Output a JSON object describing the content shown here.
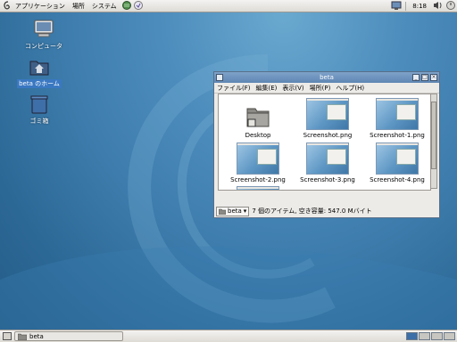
{
  "top_panel": {
    "menus": [
      {
        "label": "アプリケーション"
      },
      {
        "label": "場所"
      },
      {
        "label": "システム"
      }
    ],
    "clock": "8:18"
  },
  "desktop": {
    "icons": [
      {
        "label": "コンピュータ"
      },
      {
        "label": "beta のホーム"
      },
      {
        "label": "ゴミ箱"
      }
    ]
  },
  "window": {
    "title": "beta",
    "menu": [
      {
        "label": "ファイル(F)"
      },
      {
        "label": "編集(E)"
      },
      {
        "label": "表示(V)"
      },
      {
        "label": "場所(P)"
      },
      {
        "label": "ヘルプ(H)"
      }
    ],
    "files": [
      {
        "name": "Desktop"
      },
      {
        "name": "Screenshot.png"
      },
      {
        "name": "Screenshot-1.png"
      },
      {
        "name": "Screenshot-2.png"
      },
      {
        "name": "Screenshot-3.png"
      },
      {
        "name": "Screenshot-4.png"
      }
    ],
    "location": "beta",
    "status": "7 個のアイテム, 空き容量: 547.0 Mバイト"
  },
  "bottom_panel": {
    "task": "beta"
  },
  "colors": {
    "selection": "#3a78c2",
    "titlebar": "#6f95c0"
  }
}
